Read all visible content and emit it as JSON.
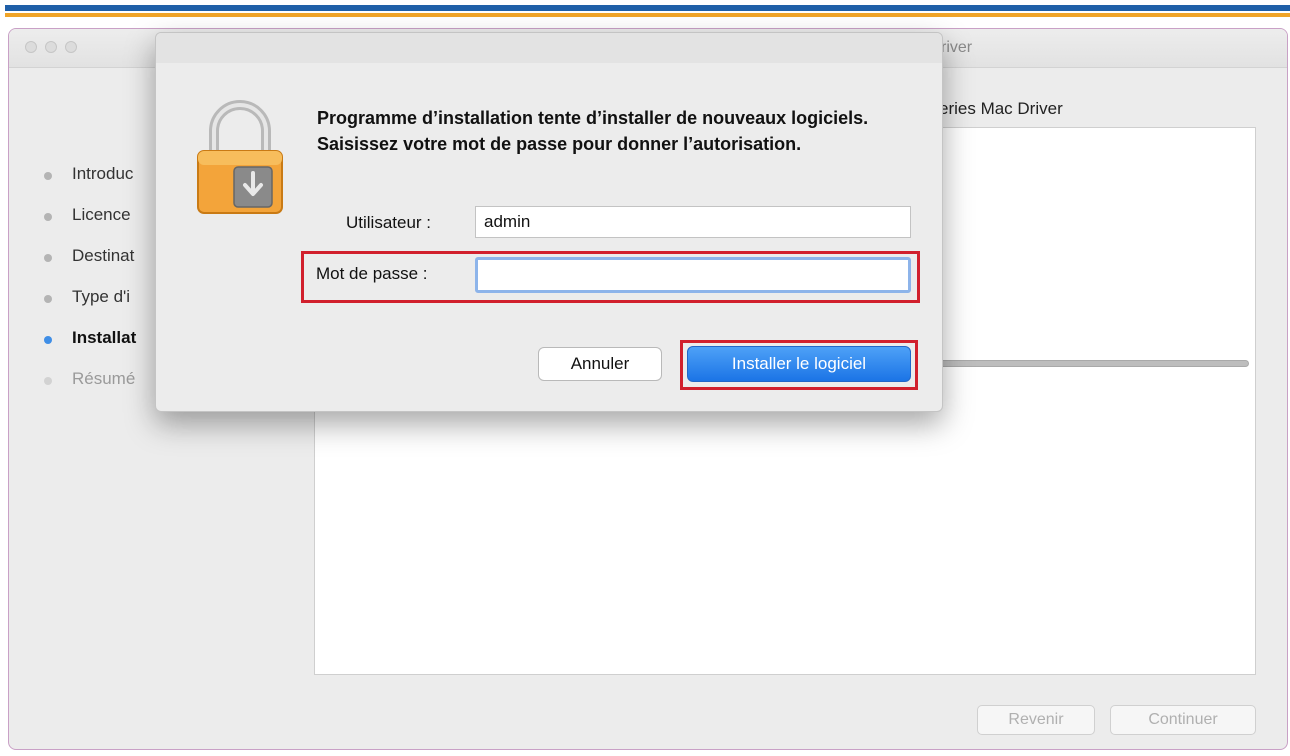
{
  "window": {
    "title_visible": "river",
    "subtitle_visible": "eries Mac Driver"
  },
  "steps": [
    {
      "label": "Introduc",
      "state": "done"
    },
    {
      "label": "Licence",
      "state": "done"
    },
    {
      "label": "Destinat",
      "state": "done"
    },
    {
      "label": "Type d'i",
      "state": "done"
    },
    {
      "label": "Installat",
      "state": "active"
    },
    {
      "label": "Résumé",
      "state": "pending"
    }
  ],
  "footer": {
    "back_label": "Revenir",
    "continue_label": "Continuer"
  },
  "dialog": {
    "message": "Programme d’installation tente d’installer de nouveaux logiciels. Saisissez votre mot de passe pour donner l’autorisation.",
    "user_label": "Utilisateur :",
    "user_value": "admin",
    "password_label": "Mot de passe :",
    "password_value": "",
    "cancel_label": "Annuler",
    "install_label": "Installer le logiciel",
    "icon": "lock-icon"
  },
  "colors": {
    "accent": "#1b74e6",
    "highlight": "#d1202d",
    "stripe_blue": "#1f5fa8",
    "stripe_orange": "#f0a428"
  }
}
